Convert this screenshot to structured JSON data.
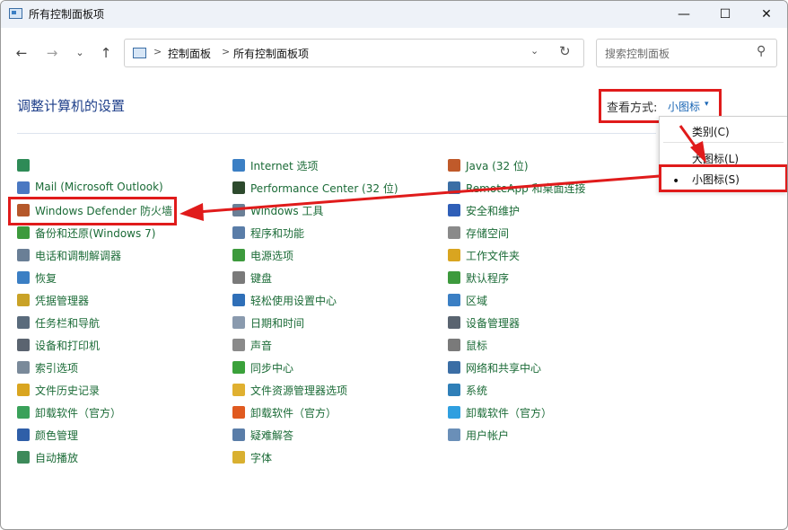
{
  "window": {
    "title": "所有控制面板项"
  },
  "address": {
    "crumb1": "控制面板",
    "crumb2": "所有控制面板项",
    "separator": ">"
  },
  "search": {
    "placeholder": "搜索控制面板"
  },
  "heading": "调整计算机的设置",
  "view": {
    "label": "查看方式:",
    "value": "小图标",
    "caret": "▾"
  },
  "menu": {
    "items": [
      "类别(C)",
      "大图标(L)",
      "小图标(S)"
    ],
    "selected_marker": "•"
  },
  "columns": [
    [
      {
        "label": "",
        "icon": "plugin-icon",
        "color": "#2e8b57"
      },
      {
        "label": "Mail (Microsoft Outlook)",
        "icon": "mail-icon",
        "color": "#4a78c2"
      },
      {
        "label": "Windows Defender 防火墙",
        "icon": "firewall-icon",
        "color": "#b5582a"
      },
      {
        "label": "备份和还原(Windows 7)",
        "icon": "backup-icon",
        "color": "#3d9a3d"
      },
      {
        "label": "电话和调制解调器",
        "icon": "phone-icon",
        "color": "#6a7f96"
      },
      {
        "label": "恢复",
        "icon": "recovery-icon",
        "color": "#3b7fc4"
      },
      {
        "label": "凭据管理器",
        "icon": "credential-icon",
        "color": "#c9a227"
      },
      {
        "label": "任务栏和导航",
        "icon": "taskbar-icon",
        "color": "#5a6b7c"
      },
      {
        "label": "设备和打印机",
        "icon": "printer-icon",
        "color": "#5b6470"
      },
      {
        "label": "索引选项",
        "icon": "index-icon",
        "color": "#7a8a9a"
      },
      {
        "label": "文件历史记录",
        "icon": "file-history-icon",
        "color": "#d9a520"
      },
      {
        "label": "卸载软件（官方）",
        "icon": "uninstall-icon",
        "color": "#3aa15a"
      },
      {
        "label": "颜色管理",
        "icon": "color-management-icon",
        "color": "#2f5fa8"
      },
      {
        "label": "自动播放",
        "icon": "autoplay-icon",
        "color": "#3d8a5a"
      }
    ],
    [
      {
        "label": "Internet 选项",
        "icon": "internet-options-icon",
        "color": "#3b7fc4"
      },
      {
        "label": "Performance Center (32 位)",
        "icon": "performance-icon",
        "color": "#2d4a2d"
      },
      {
        "label": "Windows 工具",
        "icon": "windows-tools-icon",
        "color": "#6a7f96"
      },
      {
        "label": "程序和功能",
        "icon": "programs-icon",
        "color": "#5a7da8"
      },
      {
        "label": "电源选项",
        "icon": "power-icon",
        "color": "#3d9a3d"
      },
      {
        "label": "键盘",
        "icon": "keyboard-icon",
        "color": "#7a7a7a"
      },
      {
        "label": "轻松使用设置中心",
        "icon": "ease-of-access-icon",
        "color": "#2f6fb8"
      },
      {
        "label": "日期和时间",
        "icon": "clock-icon",
        "color": "#8a9aae"
      },
      {
        "label": "声音",
        "icon": "sound-icon",
        "color": "#8a8a8a"
      },
      {
        "label": "同步中心",
        "icon": "sync-icon",
        "color": "#3aa13a"
      },
      {
        "label": "文件资源管理器选项",
        "icon": "folder-options-icon",
        "color": "#e0b030"
      },
      {
        "label": "卸载软件（官方）",
        "icon": "uninstall-icon",
        "color": "#e05a20"
      },
      {
        "label": "疑难解答",
        "icon": "troubleshoot-icon",
        "color": "#5a7da8"
      },
      {
        "label": "字体",
        "icon": "font-icon",
        "color": "#d9b030"
      }
    ],
    [
      {
        "label": "Java (32 位)",
        "icon": "java-icon",
        "color": "#c05a2a"
      },
      {
        "label": "RemoteApp 和桌面连接",
        "icon": "remoteapp-icon",
        "color": "#3b6ea5"
      },
      {
        "label": "安全和维护",
        "icon": "flag-icon",
        "color": "#2f5fb8"
      },
      {
        "label": "存储空间",
        "icon": "storage-icon",
        "color": "#8a8a8a"
      },
      {
        "label": "工作文件夹",
        "icon": "work-folders-icon",
        "color": "#d9a520"
      },
      {
        "label": "默认程序",
        "icon": "default-programs-icon",
        "color": "#3d9a3d"
      },
      {
        "label": "区域",
        "icon": "region-icon",
        "color": "#3b7fc4"
      },
      {
        "label": "设备管理器",
        "icon": "device-manager-icon",
        "color": "#5a6470"
      },
      {
        "label": "鼠标",
        "icon": "mouse-icon",
        "color": "#7a7a7a"
      },
      {
        "label": "网络和共享中心",
        "icon": "network-icon",
        "color": "#3b6ea5"
      },
      {
        "label": "系统",
        "icon": "system-icon",
        "color": "#2f7fb8"
      },
      {
        "label": "卸载软件（官方）",
        "icon": "uninstall-icon",
        "color": "#2f9fe0"
      },
      {
        "label": "用户帐户",
        "icon": "user-accounts-icon",
        "color": "#6a8fb8"
      }
    ]
  ],
  "colors": {
    "link": "#1b6b37",
    "heading": "#1e3f8a",
    "highlight": "#e01b1b",
    "accent": "#1a66b5"
  }
}
